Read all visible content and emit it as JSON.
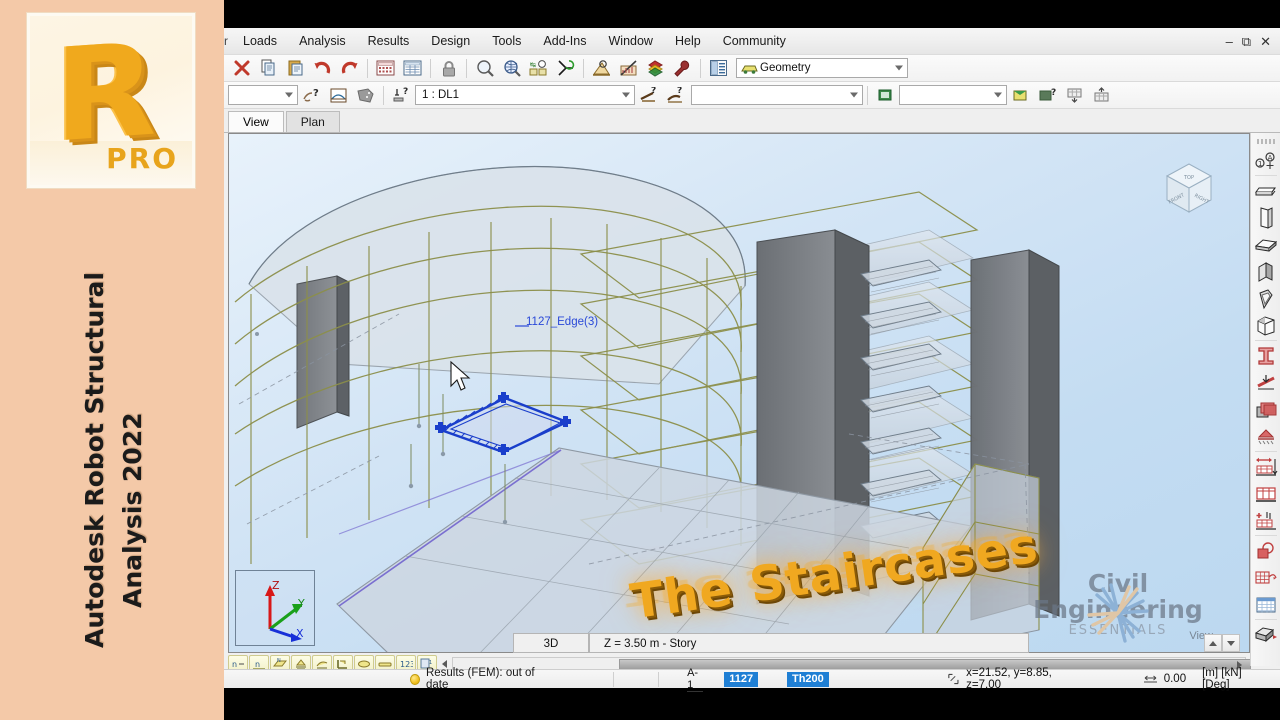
{
  "brand": {
    "logo_letter": "R",
    "logo_badge": "PRO",
    "title_line1": "Autodesk Robot Structural",
    "title_line2": "Analysis 2022",
    "panel_color": "#f4c9a8",
    "logo_color": "#f0a91d"
  },
  "menubar": {
    "truncated_first": "r",
    "items": [
      "Loads",
      "Analysis",
      "Results",
      "Design",
      "Tools",
      "Add-Ins",
      "Window",
      "Help",
      "Community"
    ],
    "window_controls": [
      "minimize",
      "restore",
      "close"
    ]
  },
  "toolbar_top": {
    "icons": [
      "delete-icon",
      "copy-icon",
      "paste-icon",
      "undo-icon",
      "redo-icon",
      "calculations-icon",
      "results-table-icon",
      "lock-icon",
      "zoom-out-icon",
      "zoom-window-icon",
      "pan-zoom-icon",
      "snap-icon",
      "display-settings-icon",
      "diagrams-icon",
      "layers-icon",
      "preferences-icon",
      "object-inspector-icon"
    ],
    "selector": {
      "label": "Geometry",
      "icon": "geometry-icon"
    }
  },
  "toolbar_second": {
    "left_combo_value": "",
    "icons": [
      "select-help-icon",
      "section-icon",
      "panel-icon",
      "load-case-icon",
      "load-type-icon",
      "load-define-icon",
      "view-map-icon",
      "view-render-icon",
      "view-query-icon",
      "table-down-icon",
      "table-up-icon"
    ],
    "load_case": "1 : DL1",
    "right_combo_value": ""
  },
  "doc_tabs": {
    "items": [
      {
        "label": "View",
        "active": true
      },
      {
        "label": "Plan",
        "active": false
      }
    ]
  },
  "viewport": {
    "selected_object_label": "1127_Edge(3)",
    "axis_gizmo": {
      "z": "Z",
      "y": "Y",
      "x": "X"
    },
    "viewcube": {
      "top": "TOP",
      "front": "FRONT",
      "right": "RIGHT"
    },
    "annotation": "The Staircases",
    "view_word": "View",
    "watermark": {
      "line1": "Civil",
      "line2": "Engineering",
      "line3": "ESSENTIALS",
      "color": "#6b7787"
    },
    "background_colors": [
      "#e8f2fb",
      "#bcd8f0"
    ],
    "selection_color": "#1a3ecb",
    "structure_colors": {
      "beam": "#8c8f4a",
      "slab": "#cfd6de",
      "wall": "#6f7378",
      "core": "#5f6368"
    }
  },
  "viewport_bottom": {
    "mode": "3D",
    "level": "Z = 3.50 m - Story",
    "icons": [
      "node-number-icon",
      "bar-number-icon",
      "panel-number-icon",
      "supports-icon",
      "loads-icon",
      "section-shape-icon",
      "section-fill-icon",
      "bar-fill-icon",
      "numbers-icon",
      "attributes-icon"
    ],
    "spin_up": "▲",
    "spin_down": "▼"
  },
  "right_toolbar": {
    "icons": [
      "node-coordinate-icon",
      "bar-icon",
      "wall-icon",
      "slab-icon",
      "panel-vertical-icon",
      "panel-angled-icon",
      "solid-icon",
      "i-section-icon",
      "release-icon",
      "thickness-icon",
      "support-icon",
      "span-dimension-icon",
      "story-icon",
      "add-story-icon",
      "cladding-icon",
      "structure-grid-icon",
      "tables-icon",
      "extrude-icon"
    ]
  },
  "statusbar": {
    "results_status": "Results (FEM): out of date",
    "results_status_indicator": "yellow",
    "attribute_label": "A-1",
    "selection_badge": "1127",
    "thickness_badge": "Th200",
    "coordinates": "x=21.52, y=8.85, z=7.00",
    "offset_value": "0.00",
    "units": "[m] [kN] [Deg]"
  }
}
